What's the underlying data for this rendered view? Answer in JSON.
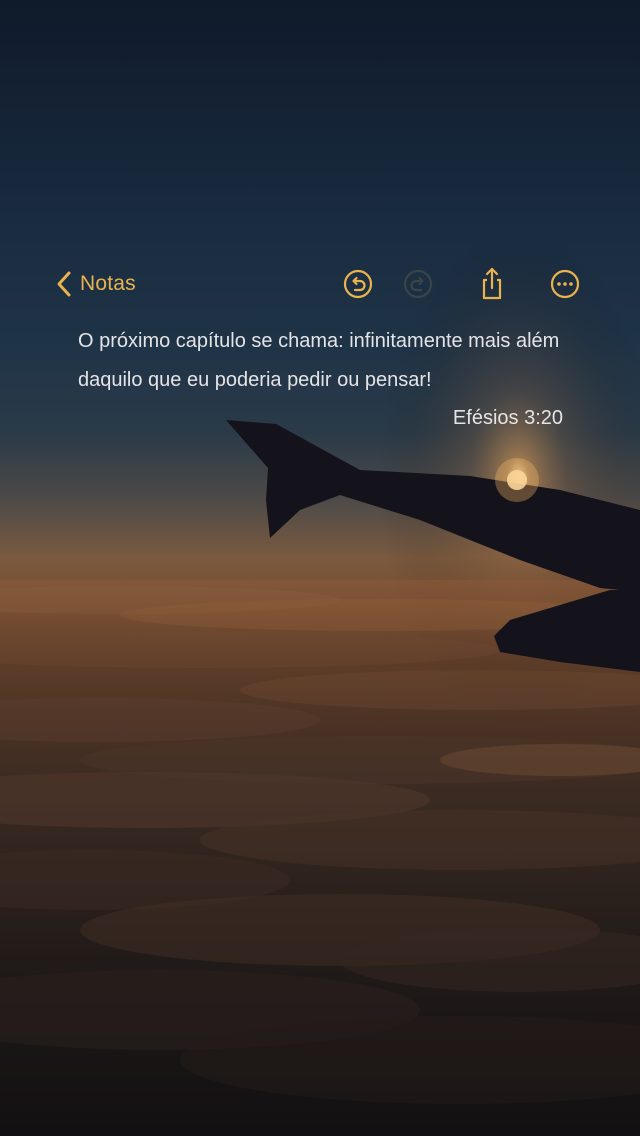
{
  "navbar": {
    "back_label": "Notas",
    "accent_color": "#e9b34e",
    "icons": [
      "chevron-left-icon",
      "undo-icon",
      "redo-icon",
      "share-icon",
      "more-icon"
    ]
  },
  "note": {
    "text": "O próximo capítulo se chama: infinitamente mais além daquilo que eu poderia pedir ou pensar!",
    "reference": "Efésios 3:20"
  },
  "background": {
    "scene": "airplane-wing-above-clouds-at-sunset"
  }
}
